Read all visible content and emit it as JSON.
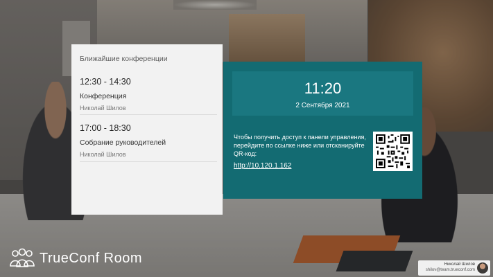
{
  "conferences": {
    "heading": "Ближайшие конференции",
    "items": [
      {
        "time": "12:30 - 14:30",
        "title": "Конференция",
        "owner": "Николай Шилов"
      },
      {
        "time": "17:00 - 18:30",
        "title": "Собрание руководителей",
        "owner": "Николай Шилов"
      }
    ]
  },
  "clock": {
    "time": "11:20",
    "date": "2 Сентября 2021"
  },
  "access": {
    "text": "Чтобы получить доступ к панели управления, перейдите по ссылке ниже или отсканируйте QR-код:",
    "link": "http://10.120.1.162"
  },
  "brand": {
    "name": "TrueConf Room"
  },
  "user": {
    "name": "Николай Шилов",
    "email": "shilov@team.trueconf.com"
  },
  "colors": {
    "panel_teal": "#136b72",
    "clock_box": "#1a7780",
    "list_bg": "#f2f2f2"
  }
}
